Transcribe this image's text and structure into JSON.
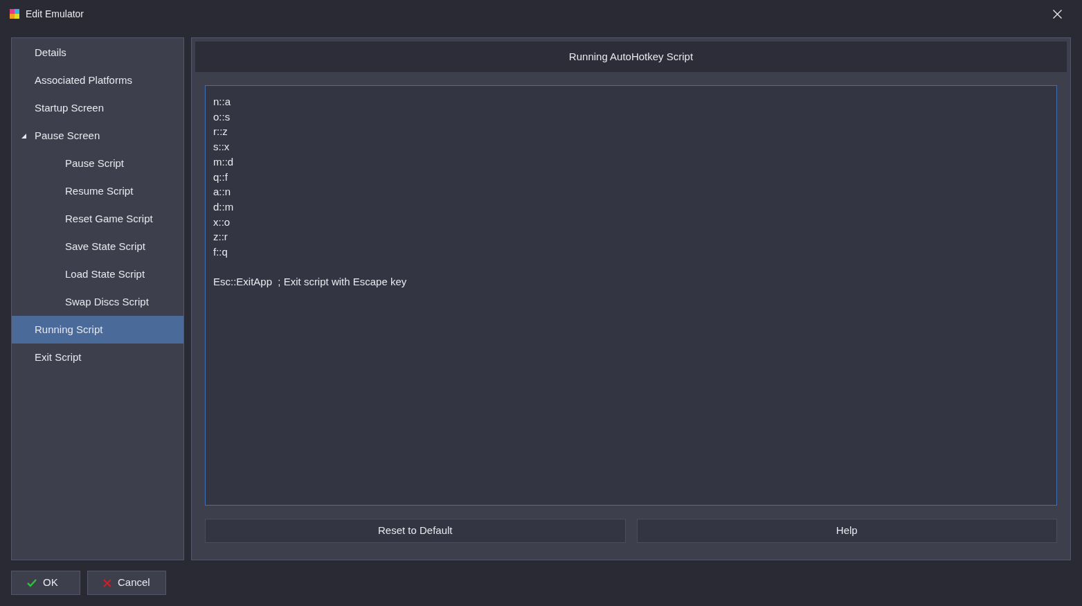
{
  "window": {
    "title": "Edit Emulator"
  },
  "sidebar": {
    "items": [
      {
        "label": "Details",
        "selected": false
      },
      {
        "label": "Associated Platforms",
        "selected": false
      },
      {
        "label": "Startup Screen",
        "selected": false
      },
      {
        "label": "Pause Screen",
        "selected": false,
        "expanded": true,
        "children": [
          {
            "label": "Pause Script",
            "selected": false
          },
          {
            "label": "Resume Script",
            "selected": false
          },
          {
            "label": "Reset Game Script",
            "selected": false
          },
          {
            "label": "Save State Script",
            "selected": false
          },
          {
            "label": "Load State Script",
            "selected": false
          },
          {
            "label": "Swap Discs Script",
            "selected": false
          }
        ]
      },
      {
        "label": "Running Script",
        "selected": true
      },
      {
        "label": "Exit Script",
        "selected": false
      }
    ]
  },
  "panel": {
    "title": "Running AutoHotkey Script",
    "script": "n::a\no::s\nr::z\ns::x\nm::d\nq::f\na::n\nd::m\nx::o\nz::r\nf::q\n\nEsc::ExitApp  ; Exit script with Escape key",
    "buttons": [
      "Reset to Default",
      "Help"
    ]
  },
  "footer_buttons": [
    {
      "kind": "ok",
      "label": "OK"
    },
    {
      "kind": "cancel",
      "label": "Cancel"
    }
  ]
}
